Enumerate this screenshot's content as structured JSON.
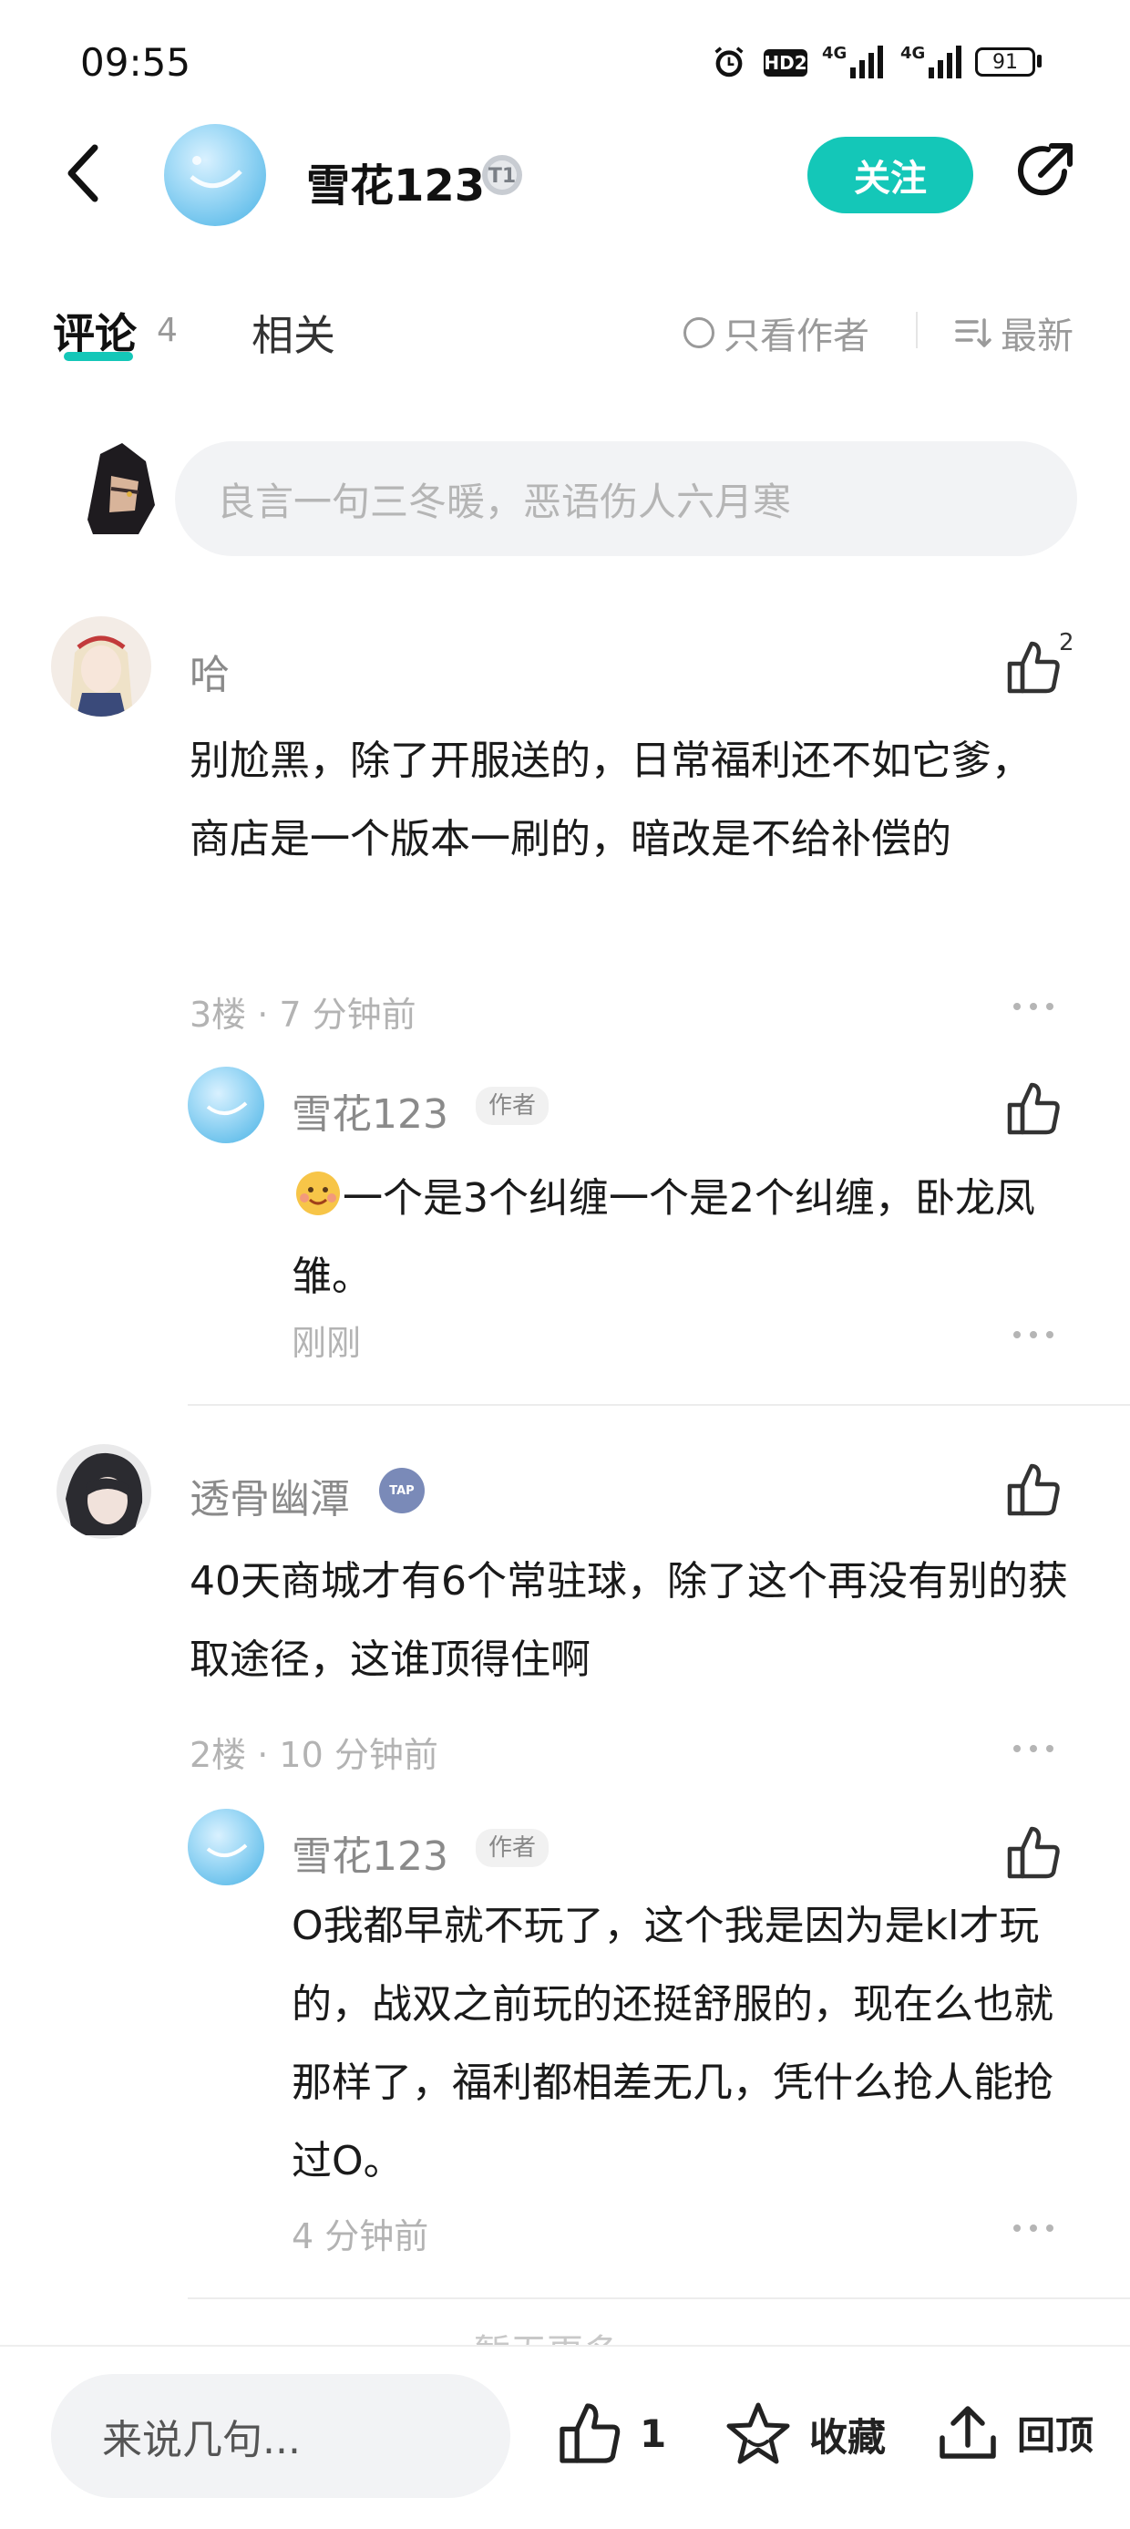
{
  "status_bar": {
    "time": "09:55",
    "battery": "91",
    "network_1": "4G",
    "network_2": "4G",
    "hd_badge": "HD2"
  },
  "header": {
    "username": "雪花123",
    "level_badge": "T1",
    "follow_label": "关注",
    "icons": [
      "back-arrow-icon",
      "share-icon"
    ]
  },
  "tabs": {
    "comments_label": "评论",
    "comments_count": "4",
    "related_label": "相关",
    "only_author_label": "只看作者",
    "sort_label": "最新"
  },
  "comment_box": {
    "placeholder": "良言一句三冬暖，恶语伤人六月寒"
  },
  "comments": [
    {
      "username": "哈",
      "like_count": "2",
      "text": "别尬黑，除了开服送的，日常福利还不如它爹，商店是一个版本一刷的，暗改是不给补偿的",
      "meta": "3楼 · 7 分钟前",
      "replies": [
        {
          "username": "雪花123",
          "author_tag": "作者",
          "text": "一个是3个纠缠一个是2个纠缠，卧龙凤雏。",
          "meta": "刚刚"
        }
      ]
    },
    {
      "username": "透骨幽潭",
      "badge": "TAP",
      "text": "40天商城才有6个常驻球，除了这个再没有别的获取途径，这谁顶得住啊",
      "meta": "2楼 · 10 分钟前",
      "replies": [
        {
          "username": "雪花123",
          "author_tag": "作者",
          "text": "O我都早就不玩了，这个我是因为是kl才玩的，战双之前玩的还挺舒服的，现在么也就那样了，福利都相差无几，凭什么抢人能抢过O。",
          "meta": "4 分钟前"
        }
      ]
    }
  ],
  "footer_hint": "暂无更多",
  "bottom_bar": {
    "input_placeholder": "来说几句...",
    "like_count": "1",
    "favorite_label": "收藏",
    "top_label": "回顶"
  },
  "colors": {
    "accent": "#14c7b8",
    "text_primary": "#1a1a1a",
    "text_secondary": "#8a8a8a",
    "input_bg": "#f2f3f5"
  }
}
